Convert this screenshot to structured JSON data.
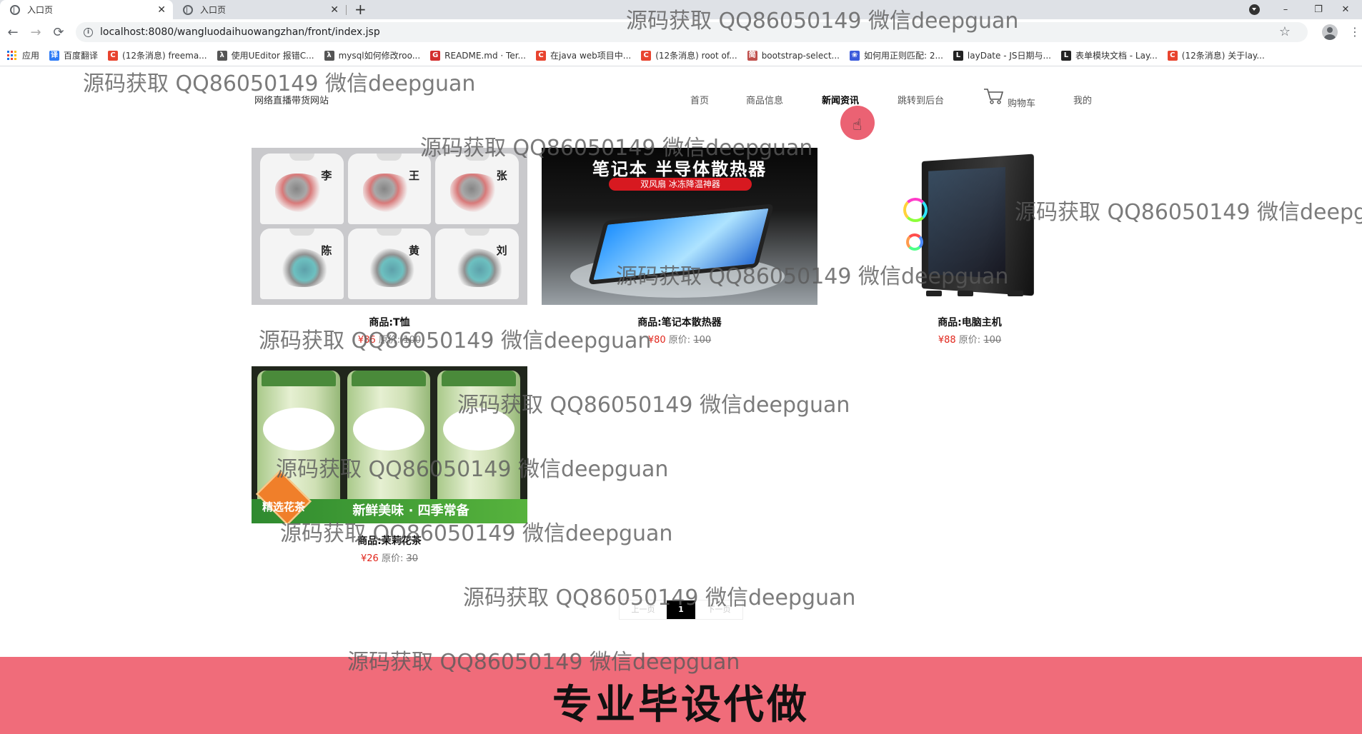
{
  "browser": {
    "tabs": [
      {
        "title": "入口页",
        "close": "✕"
      },
      {
        "title": "入口页",
        "close": "✕"
      }
    ],
    "new_tab": "+",
    "url": "localhost:8080/wangluodaihuowangzhan/front/index.jsp",
    "icons": {
      "back": "←",
      "forward": "→",
      "reload": "⟳",
      "star": "☆",
      "kebab": "⋮",
      "minimize": "–",
      "restore": "❐",
      "close": "✕",
      "info": "i"
    },
    "bookmarks": [
      {
        "label": "应用",
        "icon": "apps-grid",
        "color": ""
      },
      {
        "label": "百度翻译",
        "icon": "译",
        "color": "#2f7cf6"
      },
      {
        "label": "(12条消息) freema...",
        "icon": "C",
        "color": "#e8442f"
      },
      {
        "label": "使用UEditor 报错C...",
        "icon": "λ",
        "color": "#555555"
      },
      {
        "label": "mysql如何修改roo...",
        "icon": "λ",
        "color": "#555555"
      },
      {
        "label": "README.md · Ter...",
        "icon": "G",
        "color": "#d32f2f"
      },
      {
        "label": "在java web项目中...",
        "icon": "C",
        "color": "#e8442f"
      },
      {
        "label": "(12条消息) root of...",
        "icon": "C",
        "color": "#e8442f"
      },
      {
        "label": "bootstrap-select...",
        "icon": "简",
        "color": "#c0504d"
      },
      {
        "label": "如何用正则匹配: 2...",
        "icon": "❀",
        "color": "#3b5bdb"
      },
      {
        "label": "layDate - JS日期与...",
        "icon": "L",
        "color": "#222222"
      },
      {
        "label": "表单模块文档 - Lay...",
        "icon": "L",
        "color": "#222222"
      },
      {
        "label": "(12条消息) 关于lay...",
        "icon": "C",
        "color": "#e8442f"
      }
    ]
  },
  "site": {
    "title": "网络直播带货网站",
    "menu": [
      "首页",
      "商品信息",
      "新闻资讯",
      "跳转到后台",
      "购物车",
      "我的"
    ],
    "active_menu": "新闻资讯"
  },
  "products": [
    {
      "name": "商品:T恤",
      "price": "¥86",
      "orig_label": "原价:",
      "orig": "100",
      "shirt_chars": [
        "李",
        "王",
        "张",
        "陈",
        "黄",
        "刘"
      ]
    },
    {
      "name": "商品:笔记本散热器",
      "price": "¥80",
      "orig_label": "原价:",
      "orig": "100",
      "img_title": "笔记本 半导体散热器",
      "img_sub": "双风扇 冰冻降温神器"
    },
    {
      "name": "商品:电脑主机",
      "price": "¥88",
      "orig_label": "原价:",
      "orig": "100"
    },
    {
      "name": "商品:茉莉花茶",
      "price": "¥26",
      "orig_label": "原价:",
      "orig": "30",
      "img_banner": "新鲜美味 · 四季常备",
      "img_badge": "精选花茶"
    }
  ],
  "pagination": {
    "prev": "上一页",
    "current": "1",
    "next": "下一页"
  },
  "promo": {
    "text": "专业毕设代做",
    "color": "#f06c7a"
  },
  "watermark": "源码获取 QQ86050149 微信deepguan"
}
